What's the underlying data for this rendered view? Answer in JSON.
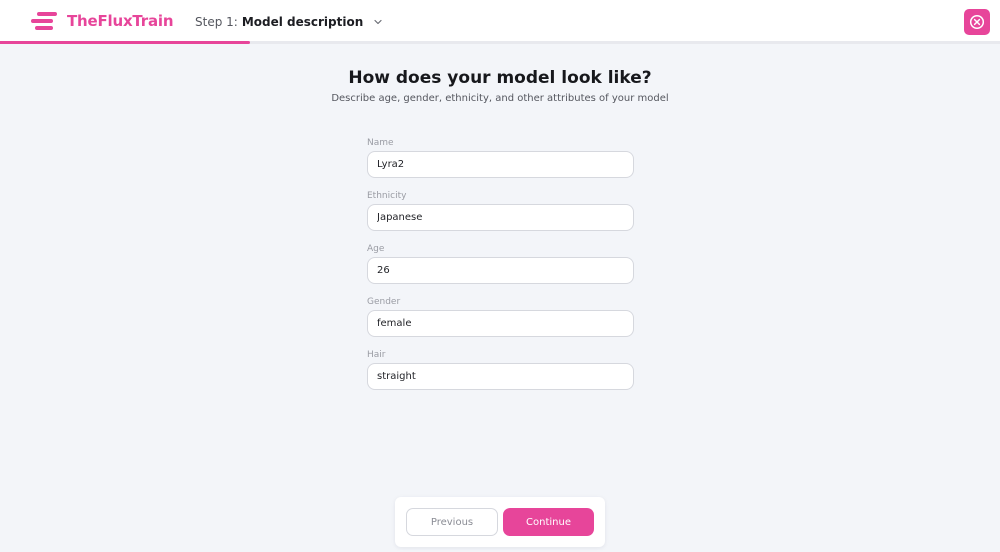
{
  "brand": {
    "name": "TheFluxTrain",
    "accent_color": "#e7459a",
    "logo_icon": "three-bars-logo-icon"
  },
  "header": {
    "step_prefix": "Step 1:",
    "step_title": "Model description",
    "step_menu_icon": "chevron-down-icon",
    "close_icon": "close-circle-icon",
    "progress_fraction": 0.25
  },
  "main": {
    "title": "How does your model look like?",
    "subtitle": "Describe age, gender, ethnicity, and other attributes of your model"
  },
  "form": {
    "fields": [
      {
        "label": "Name",
        "value": "Lyra2"
      },
      {
        "label": "Ethnicity",
        "value": "Japanese"
      },
      {
        "label": "Age",
        "value": "26"
      },
      {
        "label": "Gender",
        "value": "female"
      },
      {
        "label": "Hair",
        "value": "straight"
      }
    ]
  },
  "footer": {
    "previous_label": "Previous",
    "continue_label": "Continue"
  }
}
